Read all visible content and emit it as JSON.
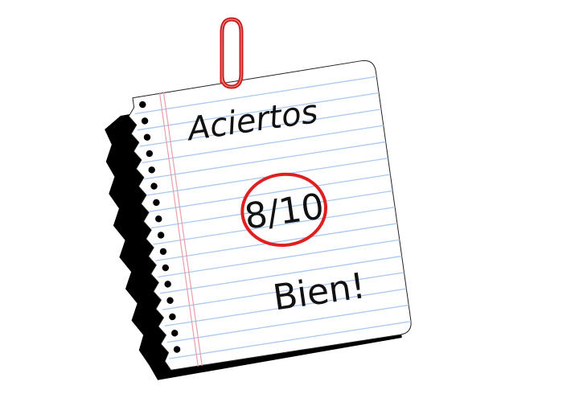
{
  "note": {
    "heading": "Aciertos",
    "score": "8/10",
    "message": "Bien!"
  },
  "colors": {
    "paper": "#ffffff",
    "rule_line": "#a9c8f2",
    "margin_line": "#e8a0a8",
    "score_circle": "#e02020",
    "paperclip": "#cc1b1b",
    "shadow": "#000000",
    "ink": "#111111"
  },
  "icons": {
    "paperclip": "paperclip-icon",
    "score_circle": "circle-mark-icon"
  }
}
